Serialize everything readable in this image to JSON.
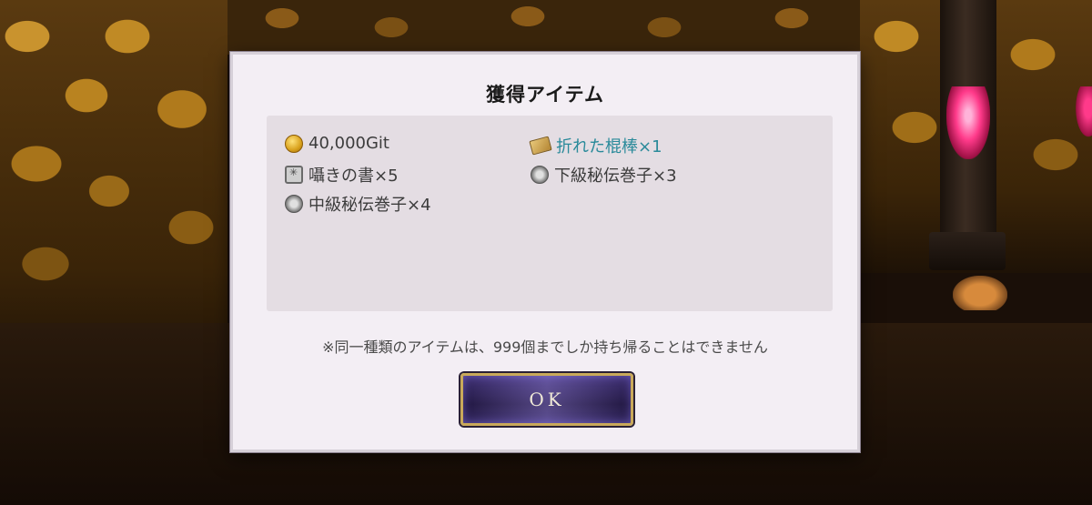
{
  "dialog": {
    "title": "獲得アイテム",
    "items": [
      {
        "icon": "coin-icon",
        "label": "40,000Git",
        "rare": false
      },
      {
        "icon": "stick-icon",
        "label": "折れた棍棒×1",
        "rare": true
      },
      {
        "icon": "book-icon",
        "label": "囁きの書×5",
        "rare": false
      },
      {
        "icon": "scroll-icon",
        "label": "下級秘伝巻子×3",
        "rare": false
      },
      {
        "icon": "scroll-icon",
        "label": "中級秘伝巻子×4",
        "rare": false
      }
    ],
    "notice": "※同一種類のアイテムは、999個までしか持ち帰ることはできません",
    "ok_label": "OK"
  },
  "colors": {
    "rare_item": "#2a8a9a",
    "button_border": "#c9a95a",
    "button_fill": "#2a1f52"
  }
}
